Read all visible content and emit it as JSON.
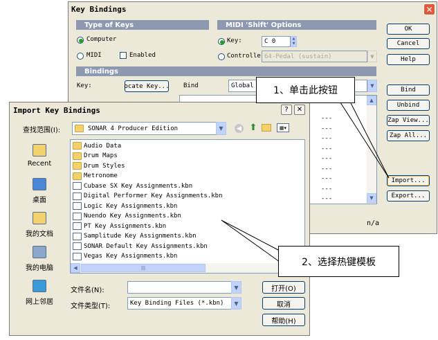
{
  "key_bindings": {
    "title": "Key Bindings",
    "type_of_keys": {
      "header": "Type of Keys",
      "computer": "Computer",
      "midi": "MIDI",
      "enabled": "Enabled"
    },
    "midi_shift": {
      "header": "MIDI 'Shift' Options",
      "key_label": "Key:",
      "key_value": "C 0",
      "controller_label": "Controlle",
      "controller_value": "64-Pedal (sustain)"
    },
    "bindings": {
      "header": "Bindings",
      "key_label": "Key:",
      "locate_key": "ocate Key...",
      "bind_label": "Bind",
      "global_value": "Global",
      "dashes": [
        "---",
        "---",
        "---",
        "---",
        "---",
        "---",
        "---",
        "---",
        "---"
      ],
      "na_text": "n/a"
    },
    "buttons": {
      "ok": "OK",
      "cancel": "Cancel",
      "help": "Help",
      "bind": "Bind",
      "unbind": "Unbind",
      "zap_view": "Zap View...",
      "zap_all": "Zap All...",
      "import": "Import...",
      "export": "Export..."
    }
  },
  "import_dialog": {
    "title": "Import Key Bindings",
    "look_in_label": "查找范围(I):",
    "look_in_value": "SONAR 4 Producer Edition",
    "places": [
      {
        "label": "Recent",
        "icon": "recent-folder-icon"
      },
      {
        "label": "桌面",
        "icon": "desktop-icon"
      },
      {
        "label": "我的文档",
        "icon": "my-documents-icon"
      },
      {
        "label": "我的电脑",
        "icon": "my-computer-icon"
      },
      {
        "label": "网上邻居",
        "icon": "network-places-icon"
      }
    ],
    "files": [
      {
        "name": "Audio Data",
        "type": "folder"
      },
      {
        "name": "Drum Maps",
        "type": "folder"
      },
      {
        "name": "Drum Styles",
        "type": "folder"
      },
      {
        "name": "Metronome",
        "type": "folder"
      },
      {
        "name": "Cubase SX Key Assignments.kbn",
        "type": "file"
      },
      {
        "name": "Digital Performer Key Assignments.kbn",
        "type": "file"
      },
      {
        "name": "Logic Key Assignments.kbn",
        "type": "file"
      },
      {
        "name": "Nuendo Key Assignments.kbn",
        "type": "file"
      },
      {
        "name": "PT Key Assignments.kbn",
        "type": "file"
      },
      {
        "name": "Samplitude Key Assignments.kbn",
        "type": "file"
      },
      {
        "name": "SONAR Default Key Assignments.kbn",
        "type": "file"
      },
      {
        "name": "Vegas Key Assignments.kbn",
        "type": "file"
      }
    ],
    "filename_label": "文件名(N):",
    "filename_value": "",
    "filetype_label": "文件类型(T):",
    "filetype_value": "Key Binding Files (*.kbn)",
    "open_button": "打开(O)",
    "cancel_button": "取消",
    "help_button": "帮助(H)",
    "help_title_btn": "?"
  },
  "callouts": {
    "step1": "1、单击此按钮",
    "step2": "2、选择热键模板"
  }
}
